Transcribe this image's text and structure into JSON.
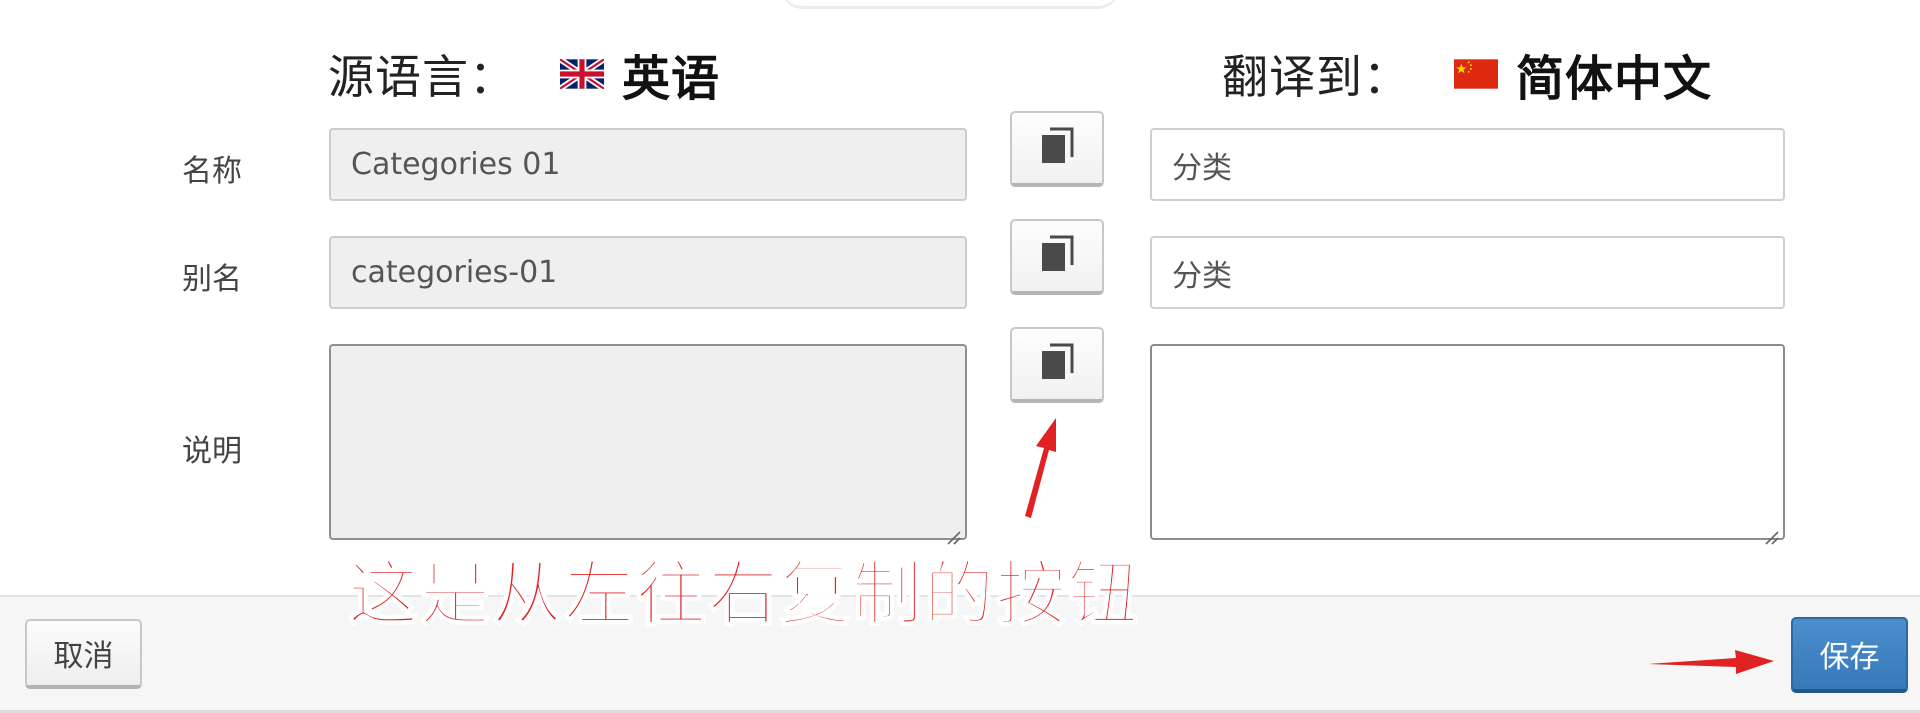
{
  "source_language": {
    "label": "源语言：",
    "name": "英语",
    "flag_icon": "uk-flag-icon"
  },
  "target_language": {
    "label": "翻译到：",
    "name": "简体中文",
    "flag_icon": "china-flag-icon"
  },
  "rows": [
    {
      "label": "名称",
      "source_value": "Categories 01",
      "target_value": "分类",
      "copy_icon": "copy-icon"
    },
    {
      "label": "别名",
      "source_value": "categories-01",
      "target_value": "分类",
      "copy_icon": "copy-icon"
    },
    {
      "label": "说明",
      "source_value": "",
      "target_value": "",
      "copy_icon": "copy-icon"
    }
  ],
  "annotation": {
    "text": "这是从左往右复制的按钮",
    "color": "#e02222"
  },
  "footer": {
    "cancel_label": "取消",
    "save_label": "保存"
  },
  "colors": {
    "primary": "#3778b8",
    "annotation": "#e02222",
    "readonly_field_bg": "#efefef"
  }
}
